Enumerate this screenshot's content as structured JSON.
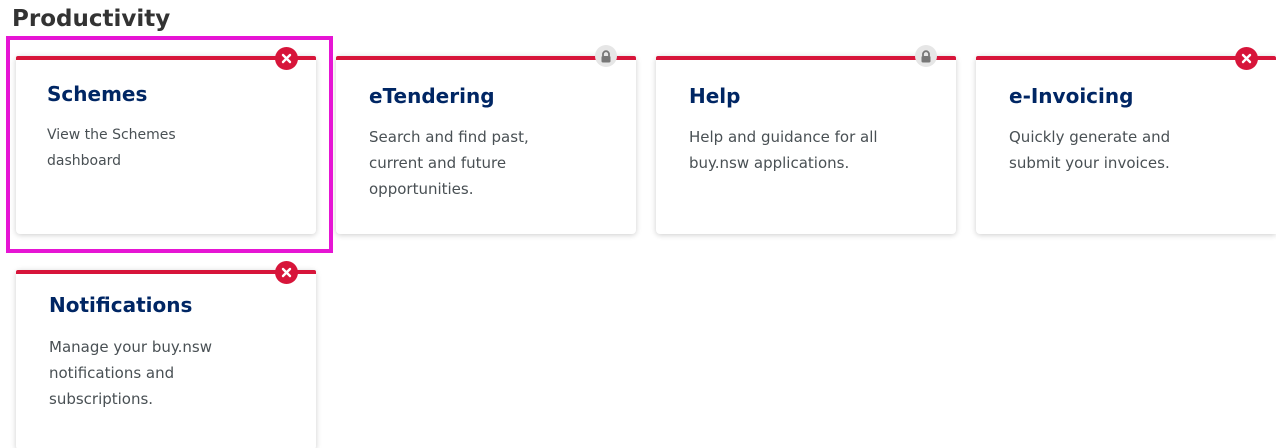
{
  "section": {
    "title": "Productivity"
  },
  "colors": {
    "accent": "#d7153a",
    "title_text": "#002664",
    "highlight": "#e615d4"
  },
  "tiles": [
    {
      "title": "Schemes",
      "description": "View the Schemes dashboard",
      "status_icon": "close-icon",
      "highlighted": true
    },
    {
      "title": "eTendering",
      "description": "Search and find past, current and future opportunities.",
      "status_icon": "lock-icon",
      "highlighted": false
    },
    {
      "title": "Help",
      "description": "Help and guidance for all buy.nsw applications.",
      "status_icon": "lock-icon",
      "highlighted": false
    },
    {
      "title": "e-Invoicing",
      "description": "Quickly generate and submit your invoices.",
      "status_icon": "close-icon",
      "highlighted": false
    },
    {
      "title": "Notifications",
      "description": "Manage your buy.nsw notifications and subscriptions.",
      "status_icon": "close-icon",
      "highlighted": false
    }
  ]
}
